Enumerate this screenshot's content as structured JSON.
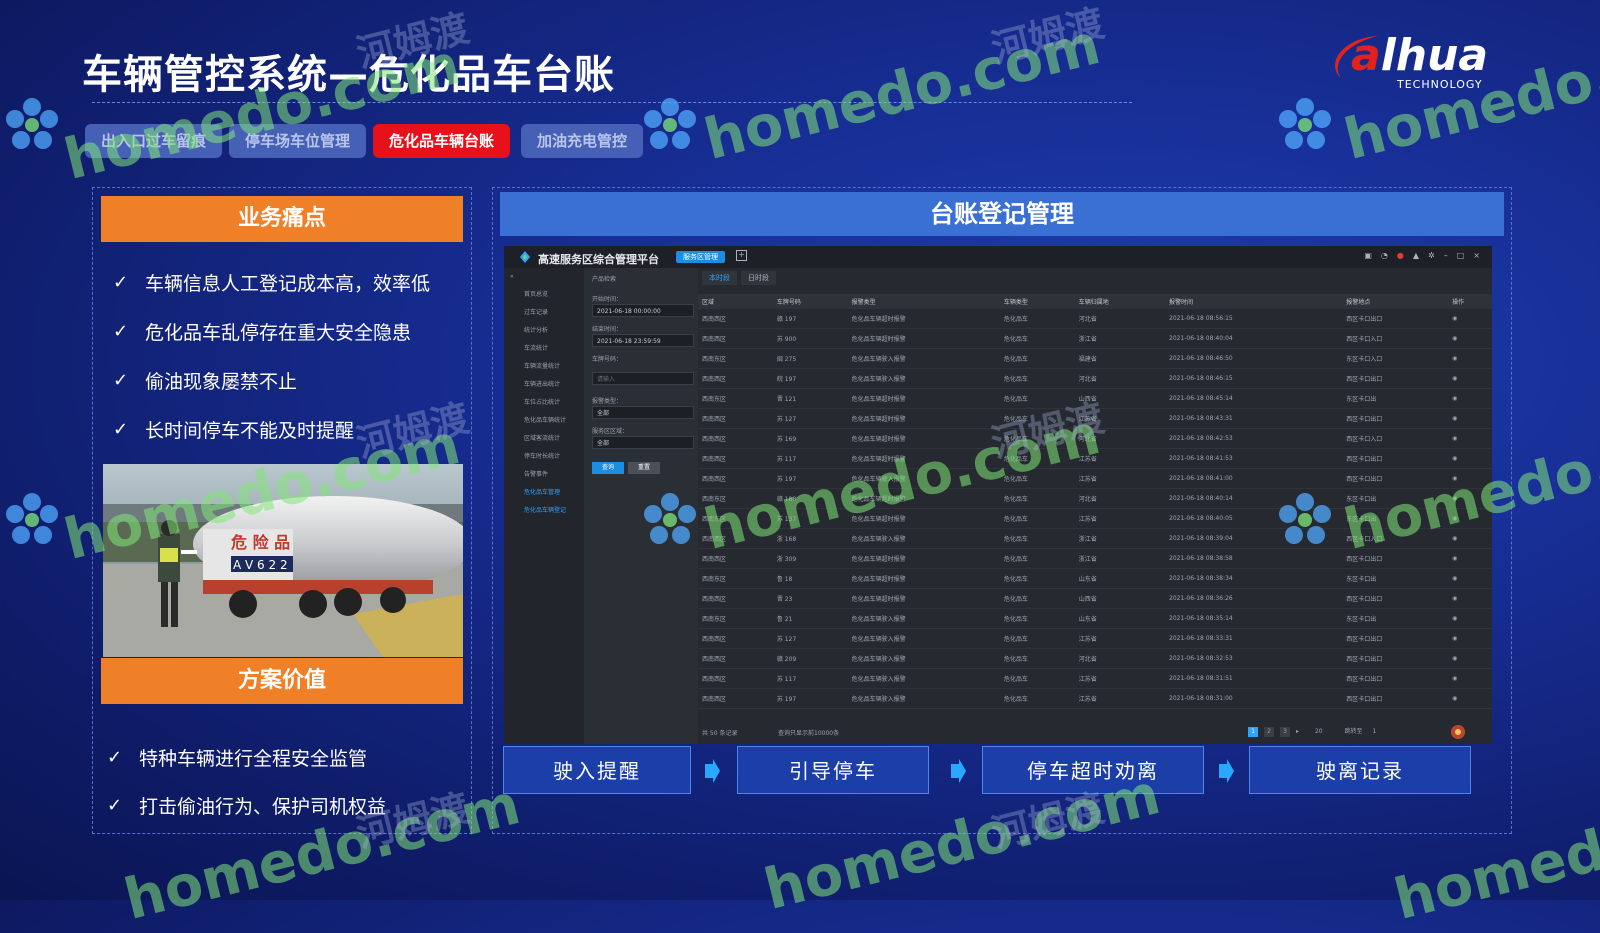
{
  "title": "车辆管控系统—危化品车台账",
  "logo": {
    "text_a": "a",
    "text_rest": "lhua",
    "sub": "TECHNOLOGY"
  },
  "tabs": [
    {
      "label": "出入口过车留痕"
    },
    {
      "label": "停车场车位管理"
    },
    {
      "label": "危化品车辆台账"
    },
    {
      "label": "加油充电管控"
    }
  ],
  "left": {
    "pain_header": "业务痛点",
    "pain_points": [
      "车辆信息人工登记成本高，效率低",
      "危化品车乱停存在重大安全隐患",
      "偷油现象屡禁不止",
      "长时间停车不能及时提醒"
    ],
    "value_header": "方案价值",
    "values": [
      "特种车辆进行全程安全监管",
      "打击偷油行为、保护司机权益"
    ],
    "photo_text": "危 险 品",
    "photo_plate": "A V 6 2 2"
  },
  "right": {
    "header": "台账登记管理",
    "screen": {
      "title": "高速服务区综合管理平台",
      "badge": "服务区管理",
      "sidebar": [
        "首页总览",
        "过车记录",
        "统计分析",
        "车流统计",
        "车辆流量统计",
        "车辆进出统计",
        "车位占比统计",
        "危化品车辆统计",
        "区域客流统计",
        "停车时长统计",
        "告警事件",
        "危化品车管理",
        "危化品车辆登记"
      ],
      "filters": {
        "tab": "产品检索",
        "start_label": "开始时间：",
        "start_value": "2021-06-18 00:00:00",
        "end_label": "结束时间：",
        "end_value": "2021-06-18 23:59:59",
        "plate_label": "车牌号码：",
        "plate_placeholder": "请输入",
        "type_label": "报警类型：",
        "type_value": "全部",
        "area_label": "服务区区域：",
        "area_value": "全部",
        "search_btn": "查询",
        "reset_btn": "重置"
      },
      "tabs": [
        "本时段",
        "日时段"
      ],
      "columns": [
        "区域",
        "车牌号码",
        "报警类型",
        "车辆类型",
        "车辆归属地",
        "报警时间",
        "报警地点",
        "操作"
      ],
      "rows": [
        [
          "西南西区",
          "赣 197",
          "危化品车辆超时报警",
          "危化品车",
          "河北省",
          "2021-06-18 08:56:15",
          "西区卡口出口",
          "◉"
        ],
        [
          "西南西区",
          "苏 900",
          "危化品车辆超时报警",
          "危化品车",
          "浙江省",
          "2021-06-18 08:40:04",
          "西区卡口入口",
          "◉"
        ],
        [
          "西南东区",
          "闽 275",
          "危化品车辆驶入报警",
          "危化品车",
          "福建省",
          "2021-06-18 08:46:50",
          "东区卡口入口",
          "◉"
        ],
        [
          "西南西区",
          "皖 197",
          "危化品车辆驶入报警",
          "危化品车",
          "河北省",
          "2021-06-18 08:46:15",
          "西区卡口出口",
          "◉"
        ],
        [
          "西南东区",
          "晋 121",
          "危化品车辆超时报警",
          "危化品车",
          "山西省",
          "2021-06-18 08:45:14",
          "东区卡口出",
          "◉"
        ],
        [
          "西南西区",
          "苏 127",
          "危化品车辆超时报警",
          "危化品车",
          "江苏省",
          "2021-06-18 08:43:31",
          "西区卡口出口",
          "◉"
        ],
        [
          "西南西区",
          "苏 169",
          "危化品车辆超时报警",
          "危化品车",
          "河北省",
          "2021-06-18 08:42:53",
          "西区卡口入口",
          "◉"
        ],
        [
          "西南西区",
          "苏 117",
          "危化品车辆超时报警",
          "危化品车",
          "江苏省",
          "2021-06-18 08:41:53",
          "西区卡口出口",
          "◉"
        ],
        [
          "西南西区",
          "苏 197",
          "危化品车辆驶入报警",
          "危化品车",
          "江苏省",
          "2021-06-18 08:41:00",
          "西区卡口出口",
          "◉"
        ],
        [
          "西南东区",
          "赣 188",
          "危化品车辆超时报警",
          "危化品车",
          "河北省",
          "2021-06-18 08:40:14",
          "东区卡口出",
          "◉"
        ],
        [
          "西南东区",
          "苏 137",
          "危化品车辆超时报警",
          "危化品车",
          "江苏省",
          "2021-06-18 08:40:05",
          "东区卡口出",
          "◉"
        ],
        [
          "西南西区",
          "浙 168",
          "危化品车辆驶入报警",
          "危化品车",
          "浙江省",
          "2021-06-18 08:39:04",
          "西区卡口入口",
          "◉"
        ],
        [
          "西南西区",
          "浙 309",
          "危化品车辆超时报警",
          "危化品车",
          "浙江省",
          "2021-06-18 08:38:58",
          "西区卡口出口",
          "◉"
        ],
        [
          "西南东区",
          "鲁 18",
          "危化品车辆超时报警",
          "危化品车",
          "山东省",
          "2021-06-18 08:38:34",
          "东区卡口出",
          "◉"
        ],
        [
          "西南西区",
          "晋 23",
          "危化品车辆超时报警",
          "危化品车",
          "山西省",
          "2021-06-18 08:36:26",
          "西区卡口出口",
          "◉"
        ],
        [
          "西南东区",
          "鲁 21",
          "危化品车辆驶入报警",
          "危化品车",
          "山东省",
          "2021-06-18 08:35:14",
          "东区卡口出",
          "◉"
        ],
        [
          "西南西区",
          "苏 127",
          "危化品车辆驶入报警",
          "危化品车",
          "江苏省",
          "2021-06-18 08:33:31",
          "西区卡口出口",
          "◉"
        ],
        [
          "西南西区",
          "赣 209",
          "危化品车辆驶入报警",
          "危化品车",
          "河北省",
          "2021-06-18 08:32:53",
          "西区卡口出口",
          "◉"
        ],
        [
          "西南西区",
          "苏 117",
          "危化品车辆驶入报警",
          "危化品车",
          "江苏省",
          "2021-06-18 08:31:51",
          "西区卡口出口",
          "◉"
        ],
        [
          "西南西区",
          "苏 197",
          "危化品车辆驶入报警",
          "危化品车",
          "江苏省",
          "2021-06-18 08:31:00",
          "西区卡口出口",
          "◉"
        ]
      ],
      "footer_total": "共 50 条记录",
      "footer_note": "查询只显示前10000条",
      "pages": [
        "1",
        "2",
        "3"
      ],
      "page_size": "20",
      "jump_label": "跳转至",
      "jump_value": "1"
    },
    "flow": [
      "驶入提醒",
      "引导停车",
      "停车超时劝离",
      "驶离记录"
    ]
  },
  "watermark": {
    "en": "homedo.com",
    "cn": "河姆渡"
  },
  "colors": {
    "accent_orange": "#f08028",
    "active_tab_red": "#e8101a",
    "header_blue": "#3a6fd4"
  }
}
